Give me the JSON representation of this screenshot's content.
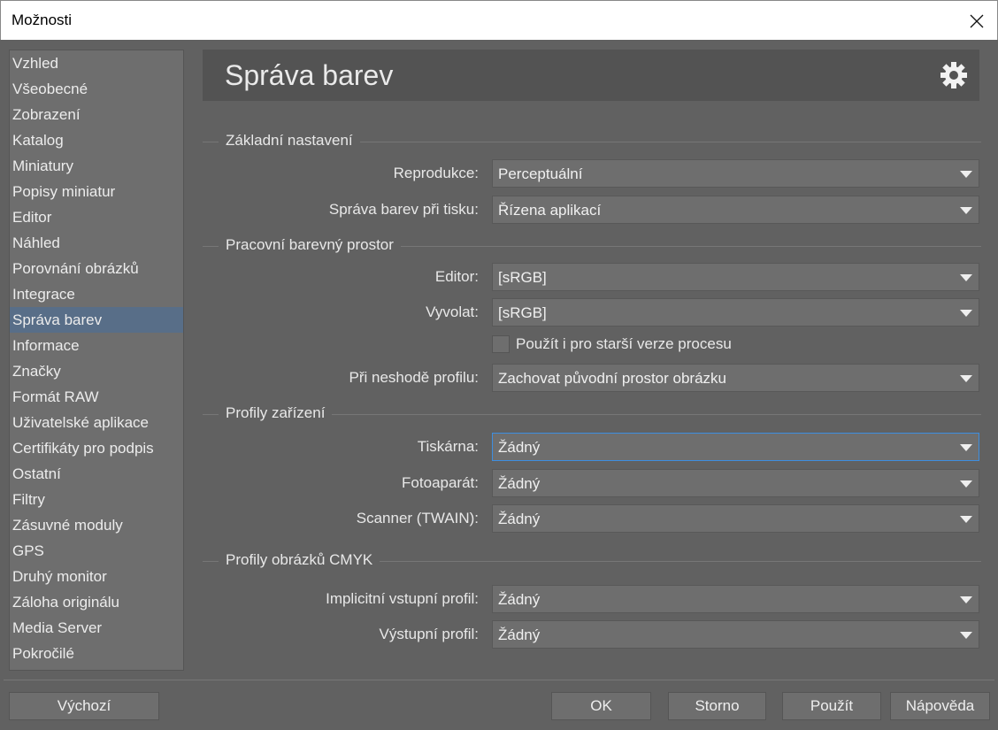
{
  "window": {
    "title": "Možnosti"
  },
  "sidebar": {
    "items": [
      "Vzhled",
      "Všeobecné",
      "Zobrazení",
      "Katalog",
      "Miniatury",
      "Popisy miniatur",
      "Editor",
      "Náhled",
      "Porovnání obrázků",
      "Integrace",
      "Správa barev",
      "Informace",
      "Značky",
      "Formát RAW",
      "Uživatelské aplikace",
      "Certifikáty pro podpis",
      "Ostatní",
      "Filtry",
      "Zásuvné moduly",
      "GPS",
      "Druhý monitor",
      "Záloha originálu",
      "Media Server",
      "Pokročilé"
    ],
    "selected": "Správa barev"
  },
  "header": {
    "title": "Správa barev",
    "icon": "gear-icon"
  },
  "groups": {
    "basic": "Základní nastavení",
    "working": "Pracovní barevný prostor",
    "devices": "Profily zařízení",
    "cmyk": "Profily obrázků CMYK"
  },
  "fields": {
    "reproduction": {
      "label": "Reprodukce:",
      "value": "Perceptuální"
    },
    "print": {
      "label": "Správa barev při tisku:",
      "value": "Řízena aplikací"
    },
    "editor": {
      "label": "Editor:",
      "value": "[sRGB]"
    },
    "develop": {
      "label": "Vyvolat:",
      "value": "[sRGB]"
    },
    "legacy": {
      "label": "Použít i pro starší verze procesu",
      "checked": false
    },
    "mismatch": {
      "label": "Při neshodě profilu:",
      "value": "Zachovat původní prostor obrázku"
    },
    "printer": {
      "label": "Tiskárna:",
      "value": "Žádný"
    },
    "camera": {
      "label": "Fotoaparát:",
      "value": "Žádný"
    },
    "scanner": {
      "label": "Scanner (TWAIN):",
      "value": "Žádný"
    },
    "input": {
      "label": "Implicitní vstupní profil:",
      "value": "Žádný"
    },
    "output": {
      "label": "Výstupní profil:",
      "value": "Žádný"
    }
  },
  "buttons": {
    "default": "Výchozí",
    "ok": "OK",
    "cancel": "Storno",
    "apply": "Použít",
    "help": "Nápověda"
  },
  "colors": {
    "selection": "#586e88",
    "focus": "#3d8ee0",
    "background": "#616161"
  }
}
